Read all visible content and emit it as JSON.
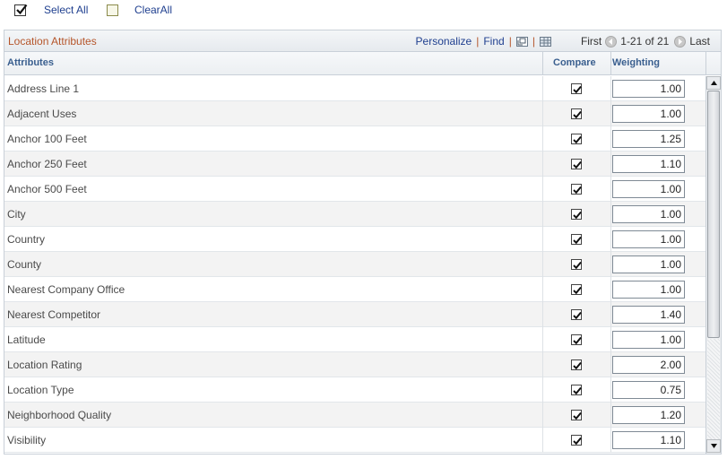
{
  "toolbar": {
    "select_all_label": "Select All",
    "clear_all_label": "ClearAll"
  },
  "grid": {
    "title": "Location Attributes",
    "nav": {
      "personalize": "Personalize",
      "find": "Find",
      "separator": "|",
      "first": "First",
      "range": "1-21 of 21",
      "last": "Last"
    },
    "headers": {
      "attributes": "Attributes",
      "compare": "Compare",
      "weighting": "Weighting"
    },
    "rows": [
      {
        "attribute": "Address Line 1",
        "compare": true,
        "weighting": "1.00"
      },
      {
        "attribute": "Adjacent Uses",
        "compare": true,
        "weighting": "1.00"
      },
      {
        "attribute": "Anchor 100 Feet",
        "compare": true,
        "weighting": "1.25"
      },
      {
        "attribute": "Anchor 250 Feet",
        "compare": true,
        "weighting": "1.10"
      },
      {
        "attribute": "Anchor 500 Feet",
        "compare": true,
        "weighting": "1.00"
      },
      {
        "attribute": "City",
        "compare": true,
        "weighting": "1.00"
      },
      {
        "attribute": "Country",
        "compare": true,
        "weighting": "1.00"
      },
      {
        "attribute": "County",
        "compare": true,
        "weighting": "1.00"
      },
      {
        "attribute": "Nearest Company Office",
        "compare": true,
        "weighting": "1.00"
      },
      {
        "attribute": "Nearest Competitor",
        "compare": true,
        "weighting": "1.40"
      },
      {
        "attribute": "Latitude",
        "compare": true,
        "weighting": "1.00"
      },
      {
        "attribute": "Location Rating",
        "compare": true,
        "weighting": "2.00"
      },
      {
        "attribute": "Location Type",
        "compare": true,
        "weighting": "0.75"
      },
      {
        "attribute": "Neighborhood Quality",
        "compare": true,
        "weighting": "1.20"
      },
      {
        "attribute": "Visibility",
        "compare": true,
        "weighting": "1.10"
      }
    ]
  },
  "icons": {
    "select_all": "checked-checkbox-icon",
    "clear_all": "empty-checkbox-icon",
    "zoom": "new-window-icon",
    "download": "download-grid-icon",
    "prev": "previous-arrow-icon",
    "next": "next-arrow-icon"
  },
  "colors": {
    "title": "#b5552a",
    "link": "#1f3f8f",
    "header_text": "#3a5f8f"
  }
}
